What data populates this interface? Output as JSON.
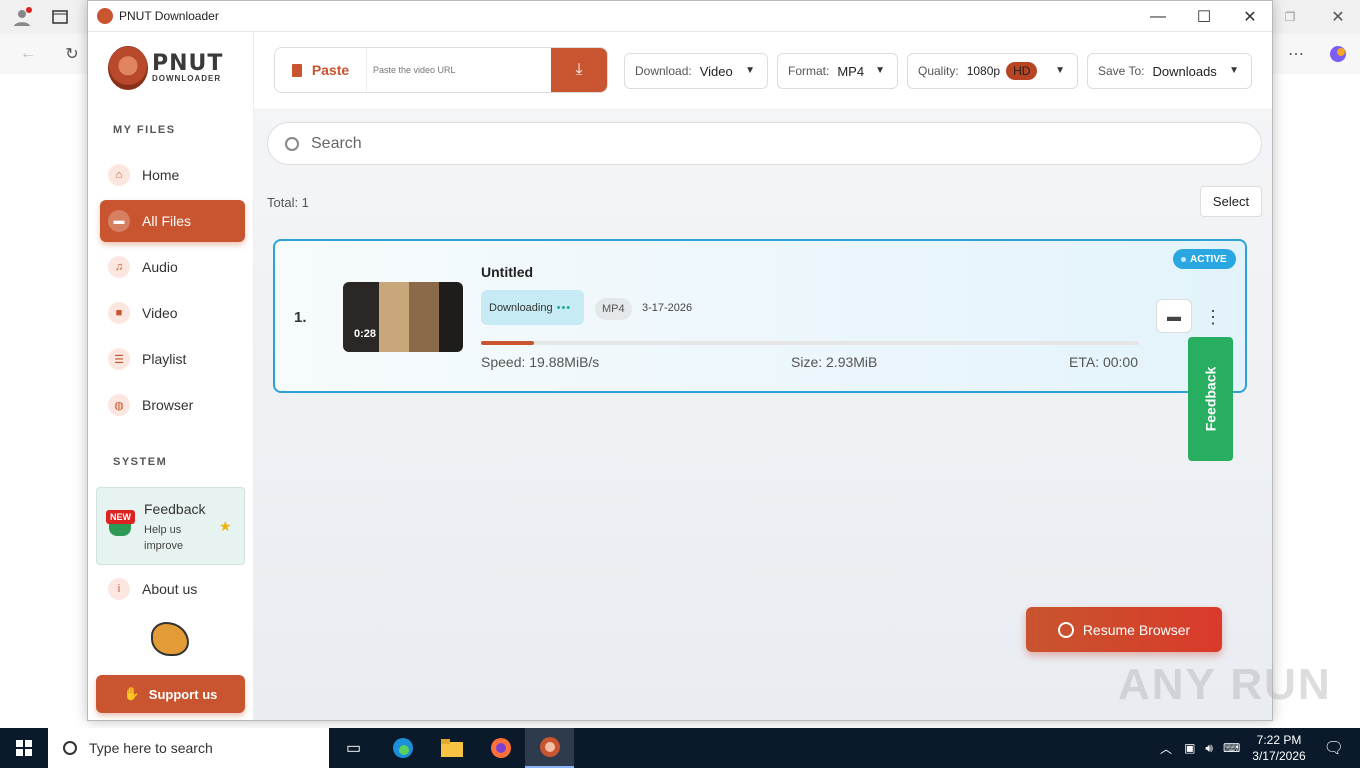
{
  "window": {
    "title": "PNUT Downloader"
  },
  "sidebar": {
    "logo_big": "PNUT",
    "logo_small": "DOWNLOADER",
    "section_files": "MY FILES",
    "items": [
      {
        "label": "Home",
        "icon": "home-icon"
      },
      {
        "label": "All Files",
        "icon": "folder-open-icon",
        "active": true
      },
      {
        "label": "Audio",
        "icon": "music-icon"
      },
      {
        "label": "Video",
        "icon": "video-icon"
      },
      {
        "label": "Playlist",
        "icon": "list-icon"
      },
      {
        "label": "Browser",
        "icon": "globe-icon"
      }
    ],
    "section_system": "SYSTEM",
    "feedback": {
      "badge": "NEW",
      "title": "Feedback",
      "subtitle": "Help us improve"
    },
    "about": "About us",
    "support": "Support us"
  },
  "toolbar": {
    "paste_label": "Paste",
    "url_placeholder": "Paste the video URL",
    "download": {
      "label": "Download:",
      "value": "Video"
    },
    "format": {
      "label": "Format:",
      "value": "MP4"
    },
    "quality": {
      "label": "Quality:",
      "value": "1080p",
      "badge": "HD"
    },
    "save_to": {
      "label": "Save To:",
      "value": "Downloads"
    }
  },
  "search": {
    "placeholder": "Search"
  },
  "list": {
    "total": "Total: 1",
    "select_label": "Select",
    "items": [
      {
        "index": "1.",
        "title": "Untitled",
        "duration": "0:28",
        "status": "Downloading",
        "format": "MP4",
        "date": "3-17-2026",
        "progress": 0.08,
        "speed": "Speed: 19.88MiB/s",
        "size": "Size: 2.93MiB",
        "eta": "ETA: 00:00",
        "badge": "ACTIVE"
      }
    ]
  },
  "feedback_tab": "Feedback",
  "resume_browser": "Resume Browser",
  "watermark": "ANY RUN",
  "taskbar": {
    "search_placeholder": "Type here to search",
    "time": "7:22 PM",
    "date": "3/17/2026"
  },
  "colors": {
    "accent": "#c8552f",
    "active_border": "#2ba3d6",
    "feedback": "#27ae60"
  }
}
